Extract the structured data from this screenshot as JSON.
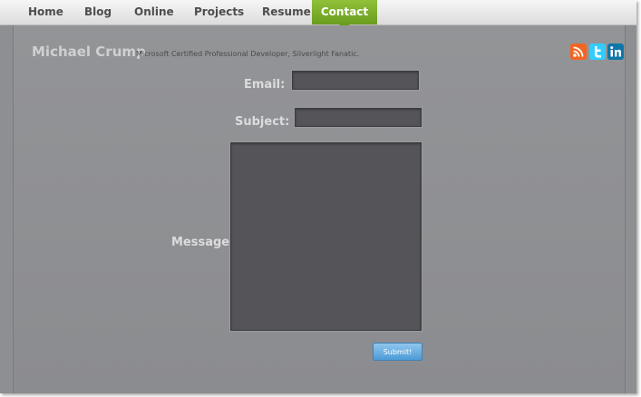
{
  "nav": {
    "items": [
      {
        "label": "Home"
      },
      {
        "label": "Blog"
      },
      {
        "label": "Online"
      },
      {
        "label": "Projects"
      },
      {
        "label": "Resume"
      },
      {
        "label": "Contact",
        "active": true
      }
    ]
  },
  "header": {
    "title": "Michael Crump",
    "tagline": "Microsoft Certified Professional Developer, Silverlight Fanatic."
  },
  "social": [
    {
      "icon": "rss-icon",
      "color": "#f26522"
    },
    {
      "icon": "twitter-icon",
      "color": "#33ccff"
    },
    {
      "icon": "linkedin-icon",
      "color": "#0e76a8"
    }
  ],
  "form": {
    "email_label": "Email:",
    "email_value": "",
    "subject_label": "Subject:",
    "subject_value": "",
    "message_label": "Message:",
    "message_value": "",
    "submit_label": "Submit!"
  },
  "colors": {
    "active_tab": "#7fb12c",
    "submit_button": "#6aaee2",
    "background": "#8e8f92"
  }
}
